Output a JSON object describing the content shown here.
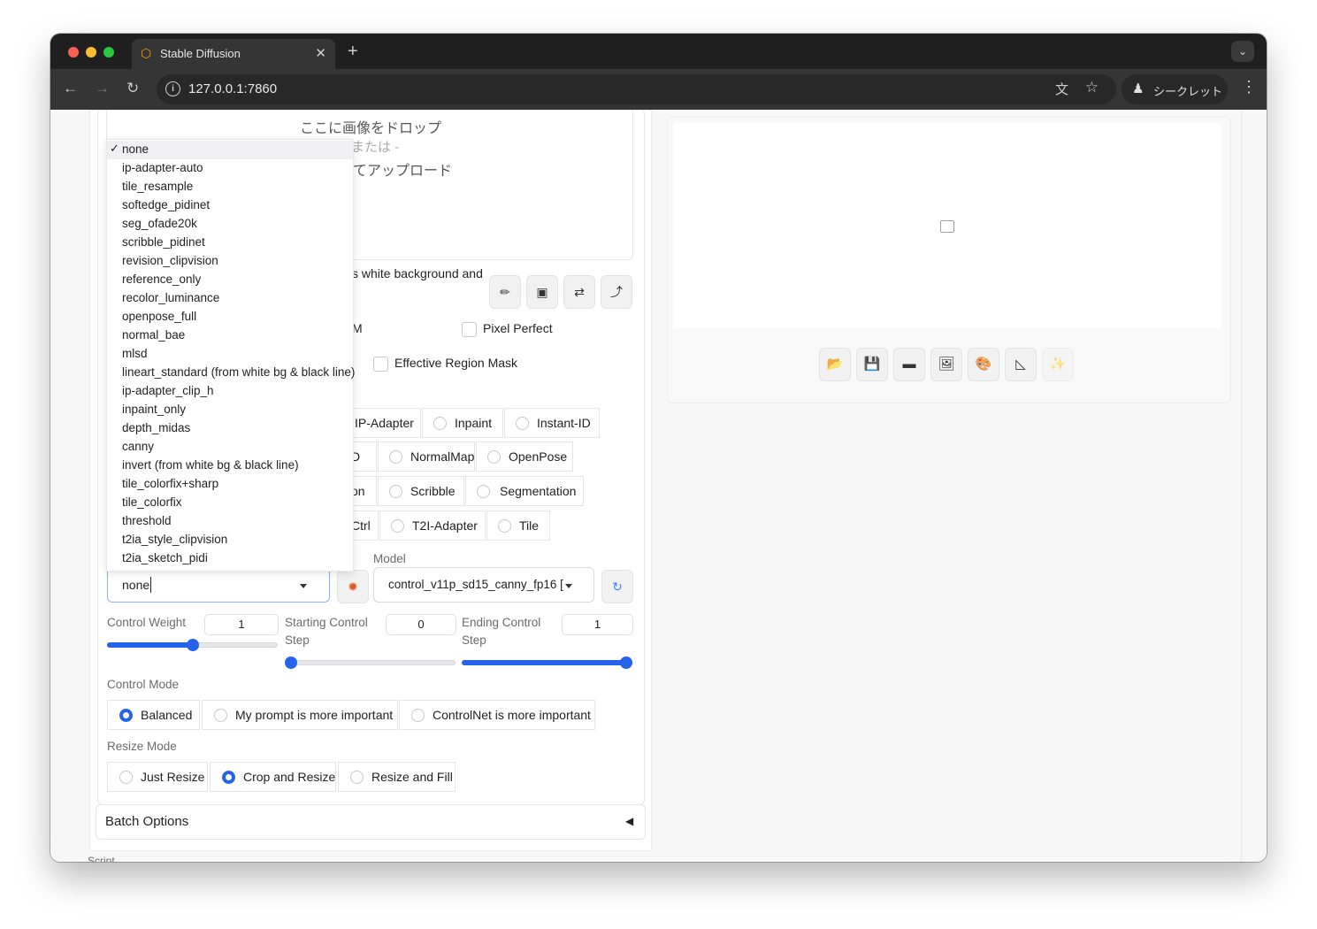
{
  "browser": {
    "tab_title": "Stable Diffusion",
    "url": "127.0.0.1:7860",
    "incognito_label": "シークレット"
  },
  "upload": {
    "drop_text": "ここに画像をドロップ",
    "or_text": "または -",
    "upload_text": "てアップロード"
  },
  "preprocessor_menu": {
    "items": [
      "none",
      "ip-adapter-auto",
      "tile_resample",
      "softedge_pidinet",
      "seg_ofade20k",
      "scribble_pidinet",
      "revision_clipvision",
      "reference_only",
      "recolor_luminance",
      "openpose_full",
      "normal_bae",
      "mlsd",
      "lineart_standard (from white bg & black line)",
      "ip-adapter_clip_h",
      "inpaint_only",
      "depth_midas",
      "canny",
      "invert (from white bg & black line)",
      "tile_colorfix+sharp",
      "tile_colorfix",
      "threshold",
      "t2ia_style_clipvision",
      "t2ia_sketch_pidi"
    ],
    "selected": "none"
  },
  "partial_texts": {
    "white_bg": "s white background and",
    "m_fragment": "M",
    "d_fragment": "D",
    "on_fragment": "on",
    "ctrl_fragment": "Ctrl"
  },
  "checkboxes": {
    "pixel_perfect": "Pixel Perfect",
    "effective_region_mask": "Effective Region Mask"
  },
  "control_types": {
    "row1": [
      "IP-Adapter",
      "Inpaint",
      "Instant-ID"
    ],
    "row2": [
      "NormalMap",
      "OpenPose"
    ],
    "row3": [
      "Scribble",
      "Segmentation"
    ],
    "row4": [
      "T2I-Adapter",
      "Tile"
    ]
  },
  "preprocessor": {
    "value": "none"
  },
  "model": {
    "label": "Model",
    "value": "control_v11p_sd15_canny_fp16 ["
  },
  "weights": {
    "control_weight_label": "Control Weight",
    "control_weight_value": "1",
    "control_weight_fraction": 0.5,
    "start_label_1": "Starting Control",
    "start_label_2": "Step",
    "start_value": "0",
    "start_fraction": 0.0,
    "end_label_1": "Ending Control",
    "end_label_2": "Step",
    "end_value": "1",
    "end_fraction": 1.0
  },
  "control_mode": {
    "label": "Control Mode",
    "options": [
      "Balanced",
      "My prompt is more important",
      "ControlNet is more important"
    ],
    "selected": "Balanced"
  },
  "resize_mode": {
    "label": "Resize Mode",
    "options": [
      "Just Resize",
      "Crop and Resize",
      "Resize and Fill"
    ],
    "selected": "Crop and Resize"
  },
  "batch": {
    "label": "Batch Options",
    "arrow": "◀"
  },
  "script_label": "Script",
  "icons": {
    "edit": "pencil-icon",
    "camera": "camera-icon",
    "swap": "swap-icon",
    "up": "upload-arrow-icon",
    "explode": "run-preprocessor-icon",
    "refresh": "refresh-icon"
  },
  "colors": {
    "accent": "#2563eb"
  }
}
